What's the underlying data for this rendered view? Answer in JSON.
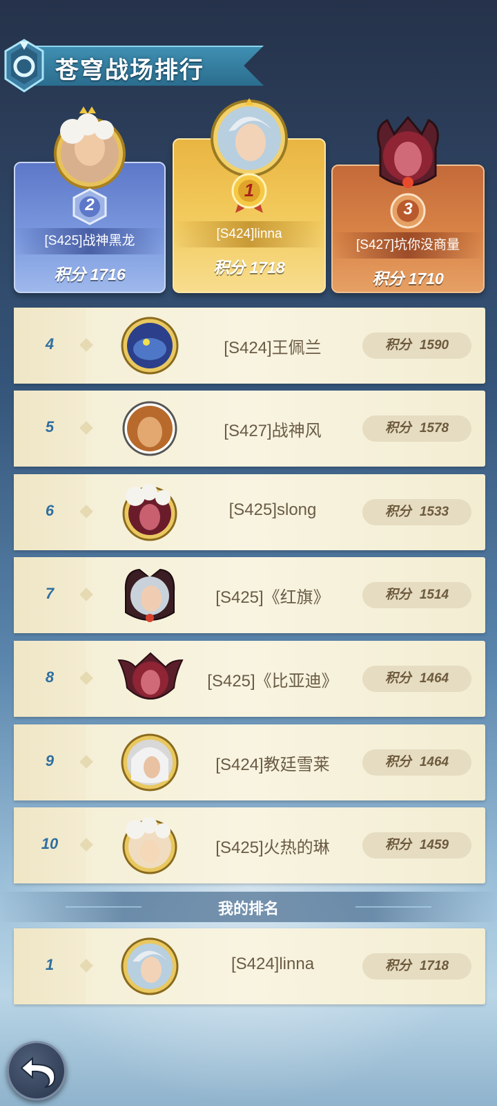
{
  "header": {
    "title": "苍穹战场排行"
  },
  "podium": [
    {
      "rank": "2",
      "name": "[S425]战神黑龙",
      "score_label": "积分",
      "score": "1716"
    },
    {
      "rank": "1",
      "name": "[S424]linna",
      "score_label": "积分",
      "score": "1718"
    },
    {
      "rank": "3",
      "name": "[S427]坑你没商量",
      "score_label": "积分",
      "score": "1710"
    }
  ],
  "rows": [
    {
      "rank": "4",
      "name": "[S424]王佩兰",
      "score_label": "积分",
      "score": "1590"
    },
    {
      "rank": "5",
      "name": "[S427]战神风",
      "score_label": "积分",
      "score": "1578"
    },
    {
      "rank": "6",
      "name": "[S425]slong",
      "score_label": "积分",
      "score": "1533"
    },
    {
      "rank": "7",
      "name": "[S425]《红旗》",
      "score_label": "积分",
      "score": "1514"
    },
    {
      "rank": "8",
      "name": "[S425]《比亚迪》",
      "score_label": "积分",
      "score": "1464"
    },
    {
      "rank": "9",
      "name": "[S424]教廷雪莱",
      "score_label": "积分",
      "score": "1464"
    },
    {
      "rank": "10",
      "name": "[S425]火热的琳",
      "score_label": "积分",
      "score": "1459"
    }
  ],
  "my_rank": {
    "section_label": "我的排名",
    "rank": "1",
    "name": "[S424]linna",
    "score_label": "积分",
    "score": "1718"
  },
  "icons": {
    "back": "back-arrow-icon",
    "banner": "crystal-emblem-icon"
  },
  "colors": {
    "gold": "#f2ca5c",
    "silver_blue": "#7d9be0",
    "bronze": "#d98447",
    "rank_text": "#2f6fa0"
  }
}
